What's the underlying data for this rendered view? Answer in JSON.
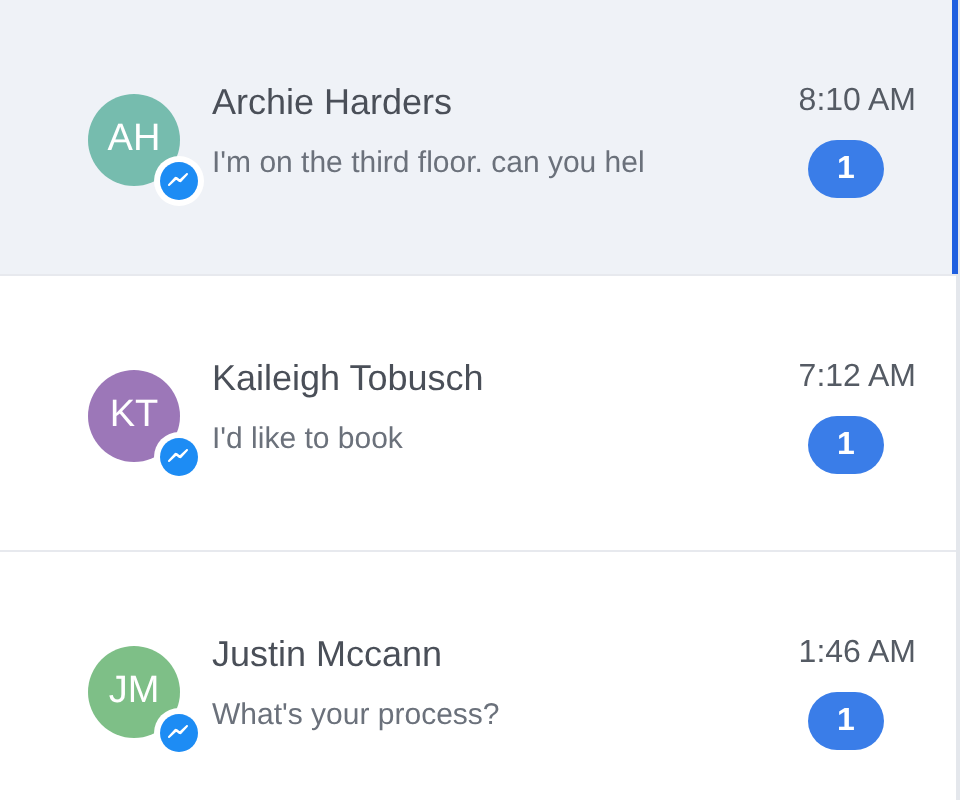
{
  "conversations": [
    {
      "initials": "AH",
      "color": "#76bcae",
      "name": "Archie Harders",
      "preview": "I'm on the third floor. can you hel",
      "time": "8:10 AM",
      "unread": "1",
      "selected": true
    },
    {
      "initials": "KT",
      "color": "#9c77b8",
      "name": "Kaileigh Tobusch",
      "preview": "I'd like to book",
      "time": "7:12 AM",
      "unread": "1",
      "selected": false
    },
    {
      "initials": "JM",
      "color": "#7ebf87",
      "name": "Justin Mccann",
      "preview": "What's your process?",
      "time": "1:46 AM",
      "unread": "1",
      "selected": false
    }
  ]
}
